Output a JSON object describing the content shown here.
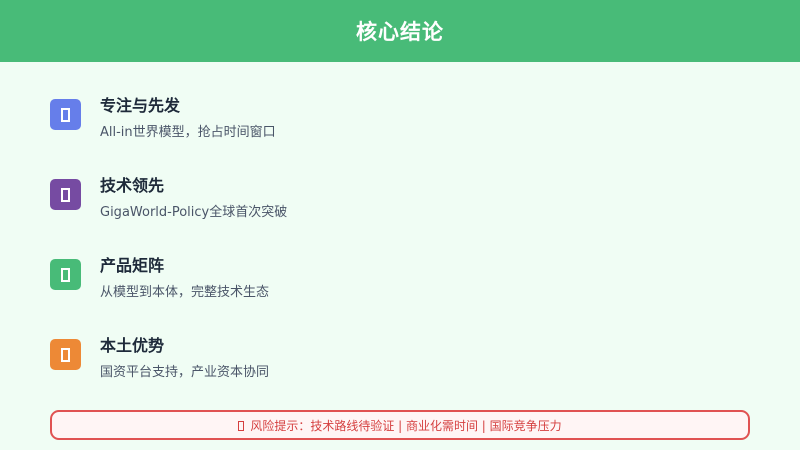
{
  "header": {
    "title": "核心结论"
  },
  "items": [
    {
      "title": "专注与先发",
      "desc": "All-in世界模型，抢占时间窗口",
      "icon": "placeholder-glyph-icon",
      "color": "#667eea"
    },
    {
      "title": "技术领先",
      "desc": "GigaWorld-Policy全球首次突破",
      "icon": "placeholder-glyph-icon",
      "color": "#764ba2"
    },
    {
      "title": "产品矩阵",
      "desc": "从模型到本体，完整技术生态",
      "icon": "placeholder-glyph-icon",
      "color": "#48bb78"
    },
    {
      "title": "本土优势",
      "desc": "国资平台支持，产业资本协同",
      "icon": "placeholder-glyph-icon",
      "color": "#ed8936"
    }
  ],
  "risk": {
    "text": "风险提示：技术路线待验证 | 商业化需时间 | 国际竞争压力",
    "icon": "warning-icon",
    "border_color": "#e05252",
    "text_color": "#d53f3f"
  },
  "colors": {
    "header_bg": "#48bb78",
    "page_bg": "#f0fdf4"
  }
}
